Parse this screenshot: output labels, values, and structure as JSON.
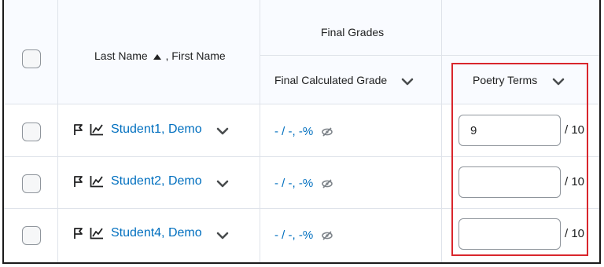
{
  "header": {
    "name_column": "Last Name",
    "name_column_suffix": ", First Name",
    "group_label": "Final Grades",
    "final_calculated_label": "Final Calculated Grade",
    "poetry_terms_label": "Poetry Terms"
  },
  "rows": [
    {
      "name": "Student1, Demo",
      "final_grade": "- / -, -%",
      "score_value": "9",
      "out_of": "/ 10"
    },
    {
      "name": "Student2, Demo",
      "final_grade": "- / -, -%",
      "score_value": "",
      "out_of": "/ 10"
    },
    {
      "name": "Student4, Demo",
      "final_grade": "- / -, -%",
      "score_value": "",
      "out_of": "/ 10"
    }
  ],
  "icons": {
    "sort": "sort-ascending-icon",
    "flag": "flag-icon",
    "stats": "progress-chart-icon",
    "hidden": "eye-hidden-icon",
    "chevron": "chevron-down-icon"
  },
  "colors": {
    "link": "#006fbf",
    "highlight": "#d9262c",
    "header_bg": "#f9fbff"
  }
}
